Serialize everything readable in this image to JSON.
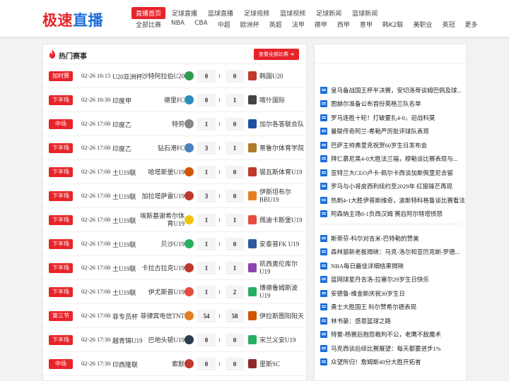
{
  "logo": {
    "part1": "极速",
    "part2": "直播"
  },
  "nav_primary": [
    "直播首页",
    "足球直播",
    "篮球直播",
    "足球视频",
    "篮球视频",
    "足球新闻",
    "篮球新闻"
  ],
  "nav_secondary": [
    "全部比赛",
    "NBA",
    "CBA",
    "中超",
    "欧洲杯",
    "英超",
    "法甲",
    "德甲",
    "西甲",
    "意甲",
    "韩K2联",
    "美职业",
    "英冠",
    "更多"
  ],
  "panel": {
    "title": "热门赛事",
    "all_button": "查看全部比赛 ➔"
  },
  "colors": {
    "accent": "#e8232a",
    "brand_blue": "#1e6fd9"
  },
  "matches": [
    {
      "status": "加时赛",
      "time": "02-26 16:15",
      "league": "U20亚洲杯",
      "home": "沙特阿拉伯U20",
      "home_score": "0",
      "away_score": "0",
      "away": "韩国U20",
      "hcolor": "#2e9b4f",
      "acolor": "#c0392b"
    },
    {
      "status": "下半场",
      "time": "02-26 16:30",
      "league": "印度甲",
      "home": "德里FC",
      "home_score": "0",
      "away_score": "1",
      "away": "喀什国际",
      "hcolor": "#2a8fbd",
      "acolor": "#444"
    },
    {
      "status": "中场",
      "time": "02-26 17:00",
      "league": "印度乙",
      "home": "特劳",
      "home_score": "1",
      "away_score": "0",
      "away": "加尔各答联合队",
      "hcolor": "#888",
      "acolor": "#1e4fa0"
    },
    {
      "status": "下半场",
      "time": "02-26 17:00",
      "league": "印度乙",
      "home": "钻石港FC",
      "home_score": "3",
      "away_score": "1",
      "away": "蒂鲁尔体育学院",
      "hcolor": "#4a7fc1",
      "acolor": "#b07a2a"
    },
    {
      "status": "下半场",
      "time": "02-26 17:00",
      "league": "土U19联",
      "home": "哈塔斯堡U19",
      "home_score": "1",
      "away_score": "0",
      "away": "锡瓦斯体育U19",
      "hcolor": "#d35400",
      "acolor": "#c0392b"
    },
    {
      "status": "下半场",
      "time": "02-26 17:00",
      "league": "土U19联",
      "home": "加拉塔萨雷U19",
      "home_score": "3",
      "away_score": "0",
      "away": "伊斯坦布尔BBU19",
      "hcolor": "#c0392b",
      "acolor": "#e67e22"
    },
    {
      "status": "下半场",
      "time": "02-26 17:00",
      "league": "土U19联",
      "home": "埃斯基谢希尔体育U19",
      "home_score": "1",
      "away_score": "1",
      "away": "佩迪卡斯堡U19",
      "hcolor": "#f1c40f",
      "acolor": "#e74c3c"
    },
    {
      "status": "下半场",
      "time": "02-26 17:00",
      "league": "土U19联",
      "home": "贝沙U19",
      "home_score": "1",
      "away_score": "0",
      "away": "安泰普FK U19",
      "hcolor": "#27ae60",
      "acolor": "#2c5aa0"
    },
    {
      "status": "下半场",
      "time": "02-26 17:00",
      "league": "土U19联",
      "home": "卡拉古拉克U19",
      "home_score": "1",
      "away_score": "1",
      "away": "凯西奥伦库尔U19",
      "hcolor": "#c0392b",
      "acolor": "#8e44ad"
    },
    {
      "status": "下半场",
      "time": "02-26 17:00",
      "league": "土U19联",
      "home": "伊尤斯普U19",
      "home_score": "1",
      "away_score": "2",
      "away": "博德鲁姆斯波U19",
      "hcolor": "#e74c3c",
      "acolor": "#27ae60"
    },
    {
      "status": "第三节",
      "time": "02-26 17:00",
      "league": "菲专员杯",
      "home": "菲律宾电信TNT",
      "home_score": "54",
      "away_score": "58",
      "away": "伊拉斯图阳阳天",
      "hcolor": "#e67e22",
      "acolor": "#d35400"
    },
    {
      "status": "下半场",
      "time": "02-26 17:30",
      "league": "越青锦U19",
      "home": "巴地头顿U19",
      "home_score": "0",
      "away_score": "0",
      "away": "宋兰义安U19",
      "hcolor": "#2c3e50",
      "acolor": "#27ae60"
    },
    {
      "status": "中场",
      "time": "02-26 17:30",
      "league": "印西隆联",
      "home": "索默",
      "home_score": "0",
      "away_score": "0",
      "away": "里斯SC",
      "hcolor": "#c0392b",
      "acolor": "#8e2a2a"
    }
  ],
  "news_group1": [
    "皇马备战国王杯半决赛，安切洛蒂谈姆巴佩及球...",
    "图赫尔准备公布首份英格兰队名单",
    "罗马连胜十轮！打破要扎4-0，迎战科莫",
    "曼联传奇阿兰-希勒严厉批评球队表现",
    "巴萨主帅弗里克祝贺60岁生日发布会",
    "拜仁慕尼黑4-0大胜法兰福，穆勒谈比赛表现与...",
    "亚特兰大CEO卢卡-佩尔卡西谈加斯佩里尼去留",
    "罗马与小将皮西利续约至2029年 红狼锋芒再现",
    "热刺4-1大胜伊普斯维奇，波斯特科格鲁谈比赛看法",
    "阿森纳主场0-1负西汉姆 赛后阿尔特塔愤怒"
  ],
  "news_group2": [
    "斯蒂芬-科尔对吉米-巴特勒的赞美",
    "森林狼新老板揭晓：马克-洛尔和亚历克斯-罗德...",
    "NBA每日最佳详细结果揭晓",
    "篮网球星丹吉洛-拉塞尔29岁生日快乐",
    "安德鲁-维金斯庆祝30岁生日",
    "勇士大胜国王 科尔赞希尔德表现",
    "林书豪：感恩篮球之路",
    "特雷-杨赛后抱怨裁判不公，老鹰不敌魔术",
    "马克西谈后续比赛展望：每天都要进步1%",
    "众望所归！詹姆斯40分大胜开拓者"
  ]
}
